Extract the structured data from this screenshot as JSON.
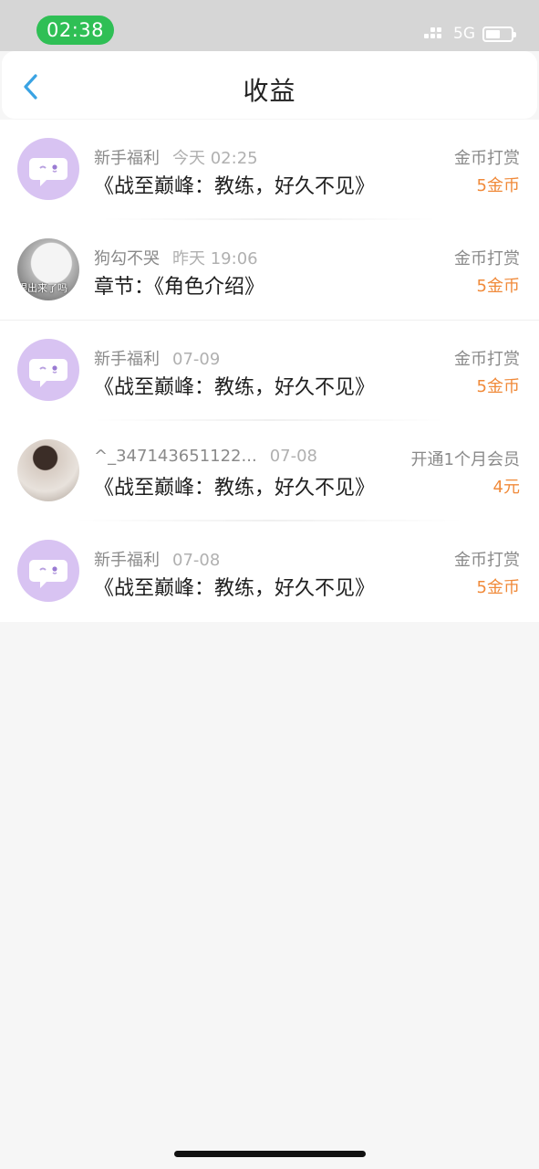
{
  "status_bar": {
    "time": "02:38",
    "network": "5G"
  },
  "header": {
    "title": "收益",
    "back_icon": "chevron-left-icon",
    "accent": "#3aa3e3"
  },
  "colors": {
    "amount": "#f08a3a",
    "avatar_bot_bg": "#d8c3f2",
    "status_green": "#2fbf55"
  },
  "items": [
    {
      "avatar": "chat-bubble-icon",
      "name": "新手福利",
      "time": "今天 02:25",
      "title": "《战至巅峰：教练，好久不见》",
      "type": "金币打赏",
      "amount": "5金币"
    },
    {
      "avatar": "user-photo",
      "avatar_text": "跟出来了吗",
      "name": "狗勾不哭",
      "time": "昨天 19:06",
      "title": "章节：《角色介绍》",
      "type": "金币打赏",
      "amount": "5金币"
    },
    {
      "avatar": "chat-bubble-icon",
      "name": "新手福利",
      "time": "07-09",
      "title": "《战至巅峰：教练，好久不见》",
      "type": "金币打赏",
      "amount": "5金币"
    },
    {
      "avatar": "user-photo",
      "name": "^_347143651122...",
      "time": "07-08",
      "title": "《战至巅峰：教练，好久不见》",
      "type": "开通1个月会员",
      "amount": "4元"
    },
    {
      "avatar": "chat-bubble-icon",
      "name": "新手福利",
      "time": "07-08",
      "title": "《战至巅峰：教练，好久不见》",
      "type": "金币打赏",
      "amount": "5金币"
    }
  ]
}
